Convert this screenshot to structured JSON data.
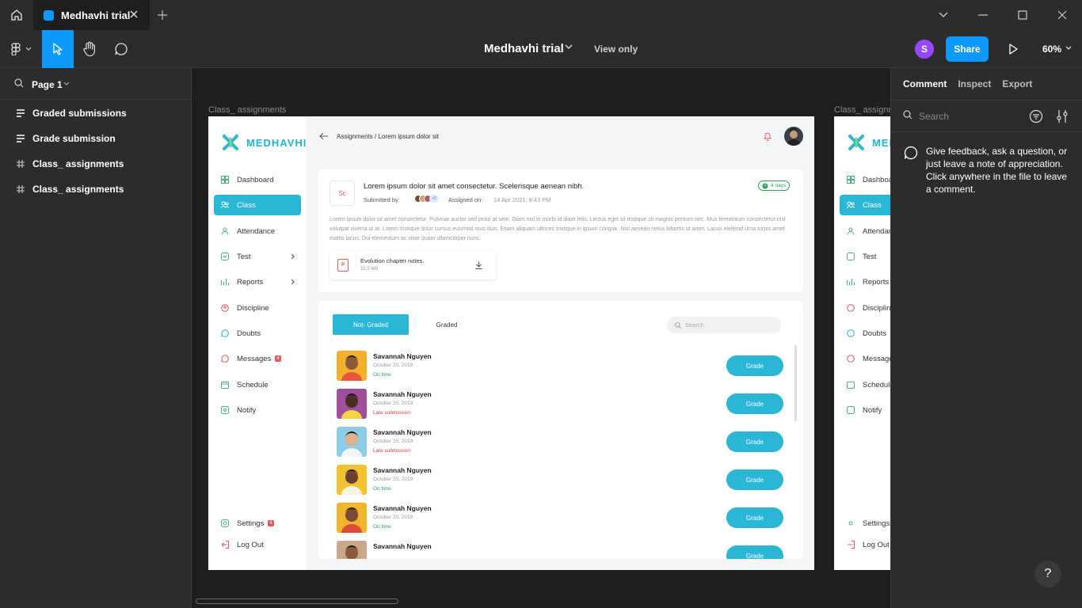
{
  "window": {
    "tab_title": "Medhavhi trial",
    "new_tab": "+"
  },
  "toolbar": {
    "file_title": "Medhavhi trial",
    "view_only": "View only",
    "user_initial": "S",
    "share_label": "Share",
    "zoom": "60%"
  },
  "left_panel": {
    "page_label": "Page 1",
    "layers": [
      {
        "label": "Graded submissions",
        "icon": "text-lines-icon"
      },
      {
        "label": "Grade submission",
        "icon": "text-lines-icon"
      },
      {
        "label": "Class_ assignments",
        "icon": "frame-hash-icon"
      },
      {
        "label": "Class_ assignments",
        "icon": "frame-hash-icon"
      }
    ]
  },
  "canvas": {
    "frame1_label": "Class_ assignments",
    "frame2_label": "Class_ assignm"
  },
  "right_panel": {
    "tabs": [
      "Comment",
      "Inspect",
      "Export"
    ],
    "search_placeholder": "Search",
    "hint": "Give feedback, ask a question, or just leave a note of appreciation. Click anywhere in the file to leave a comment.",
    "help": "?"
  },
  "app": {
    "logo": "MEDHAVHI",
    "nav": [
      {
        "label": "Dashboard"
      },
      {
        "label": "Class",
        "active": true
      },
      {
        "label": "Attendance"
      },
      {
        "label": "Test",
        "has_chevron": true
      },
      {
        "label": "Reports",
        "has_chevron": true
      },
      {
        "label": "Discipline"
      },
      {
        "label": "Doubts"
      },
      {
        "label": "Messages",
        "badge": "4"
      },
      {
        "label": "Schedule"
      },
      {
        "label": "Notify"
      }
    ],
    "settings": {
      "label": "Settings",
      "badge": "4"
    },
    "logout": "Log Out",
    "breadcrumb": "Assignments / Lorem ipsum dolor sit",
    "assignment": {
      "subject_code": "Sc",
      "title": "Lorem ipsum dolor sit amet consectetur. Scelerisque aenean nibh.",
      "submitted_by": "Submitted by:",
      "assigned_on_label": "Assigned on:",
      "assigned_on": "14 Apr 2021, 8:43 PM",
      "days": "4 days",
      "avatars_more": "+2",
      "description": "Lorem ipsum dolor sit amet consectetur. Pulvinar auctor sed proin at sem. Diam nisl in morbi id diam felis. Lectus eget sit tristique sit magnis pretium nec. Mus fermentum consectetur nisl volutpat viverra ut at. Lorem tristique dolor cursus euismod mus duis. Etiam aliquam ultrices tristique in ipsum congue. Nisl aenean netus lobortis ut amet. Lacus eleifend urna turpis amet mattis lacus. Dui elementum ac vitae quam ullamcorper nunc.",
      "file_name": "Evolution chapter notes.",
      "file_size": "32.5 MB"
    },
    "tabs": [
      "Not- Graded",
      "Graded"
    ],
    "search_placeholder": "Search",
    "grade_label": "Grade",
    "students": [
      {
        "name": "Savannah Nguyen",
        "date": "October 25, 2019",
        "status": "On time",
        "late": false,
        "bg": "#f3b12b",
        "skin": "#8a5a3b",
        "shirt": "#e8553a"
      },
      {
        "name": "Savannah Nguyen",
        "date": "October 25, 2019",
        "status": "Late submission",
        "late": true,
        "bg": "#a0509a",
        "skin": "#4a2e22",
        "shirt": "#f2d542"
      },
      {
        "name": "Savannah Nguyen",
        "date": "October 25, 2019",
        "status": "Late submission",
        "late": true,
        "bg": "#8ecde8",
        "skin": "#e3b08a",
        "shirt": "#f4f4f4"
      },
      {
        "name": "Savannah Nguyen",
        "date": "October 25, 2019",
        "status": "On time",
        "late": false,
        "bg": "#f2c230",
        "skin": "#6b4030",
        "shirt": "#f7f2e6"
      },
      {
        "name": "Savannah Nguyen",
        "date": "October 25, 2019",
        "status": "On time",
        "late": false,
        "bg": "#f0b52a",
        "skin": "#7a4a32",
        "shirt": "#e04a3a"
      },
      {
        "name": "Savannah Nguyen",
        "date": "",
        "status": "",
        "late": false,
        "bg": "#c9a88a",
        "skin": "#8a5a3b",
        "shirt": "#ddd"
      }
    ]
  },
  "colors": {
    "accent": "#0d99ff",
    "app_accent": "#2ab7d6",
    "purple_avatar": "#9747ff",
    "late": "#e0394a",
    "ontime": "#23a35a"
  }
}
